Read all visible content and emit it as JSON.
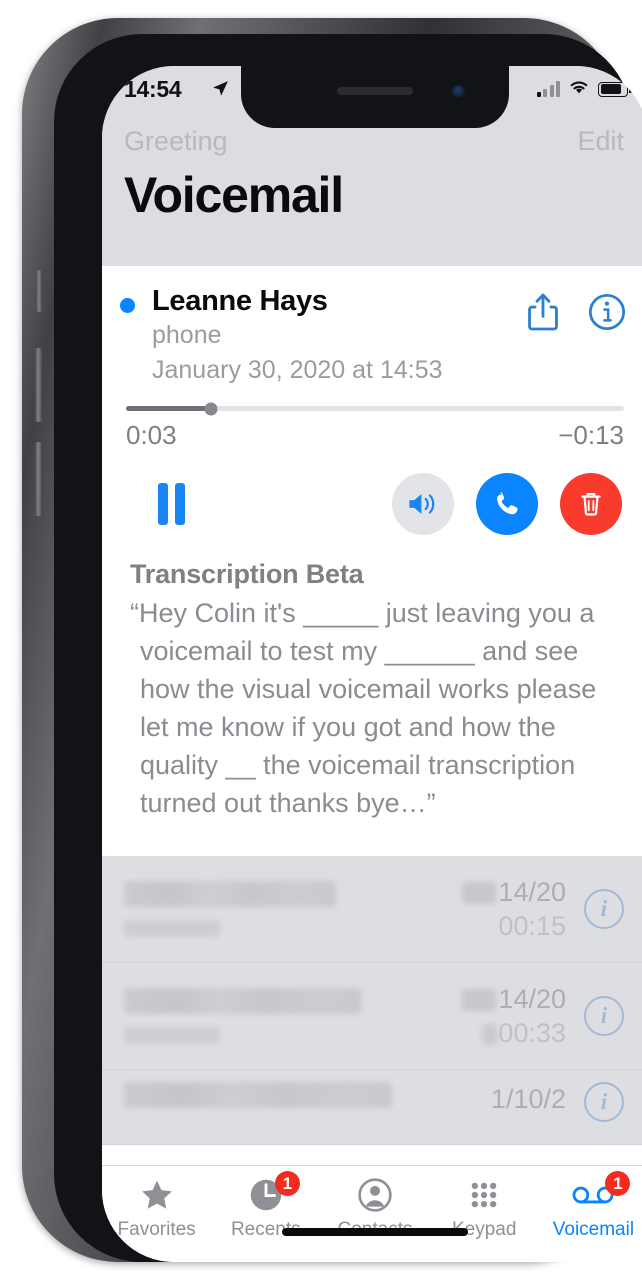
{
  "status_bar": {
    "time": "14:54",
    "location_icon": "location-arrow-icon",
    "signal_icon": "cellular-signal-icon",
    "wifi_icon": "wifi-icon",
    "battery_icon": "battery-icon"
  },
  "nav": {
    "greeting_label": "Greeting",
    "edit_label": "Edit",
    "title": "Voicemail"
  },
  "voicemail": {
    "name": "Leanne Hays",
    "label": "phone",
    "date": "January 30, 2020 at 14:53",
    "share_icon": "share-icon",
    "info_icon": "info-icon",
    "elapsed": "0:03",
    "remaining": "−0:13",
    "progress_percent": 17,
    "pause_icon": "pause-icon",
    "speaker_icon": "speaker-icon",
    "call_icon": "phone-call-icon",
    "delete_icon": "trash-icon",
    "transcription_title": "Transcription Beta",
    "transcription_text": "“Hey Colin it's _____ just leaving you a voicemail to test my ______ and see how the visual voicemail works please let me know if you got and how the quality __ the voicemail transcription turned out thanks bye…”"
  },
  "list_rows": [
    {
      "date": "14/20",
      "duration": "00:15",
      "info_icon": "info-icon"
    },
    {
      "date": "14/20",
      "duration": "00:33",
      "info_icon": "info-icon"
    },
    {
      "date": "1/10/2",
      "duration": "",
      "info_icon": "info-icon"
    }
  ],
  "tabs": [
    {
      "label": "Favorites",
      "icon": "star-icon",
      "badge": "",
      "active": false
    },
    {
      "label": "Recents",
      "icon": "clock-icon",
      "badge": "1",
      "active": false
    },
    {
      "label": "Contacts",
      "icon": "person-circle-icon",
      "badge": "",
      "active": false
    },
    {
      "label": "Keypad",
      "icon": "keypad-icon",
      "badge": "",
      "active": false
    },
    {
      "label": "Voicemail",
      "icon": "voicemail-icon",
      "badge": "1",
      "active": true
    }
  ],
  "colors": {
    "accent_blue": "#0a84ff",
    "delete_red": "#f93b2e",
    "badge_red": "#f62b20",
    "nav_bg": "#dcdde0"
  }
}
